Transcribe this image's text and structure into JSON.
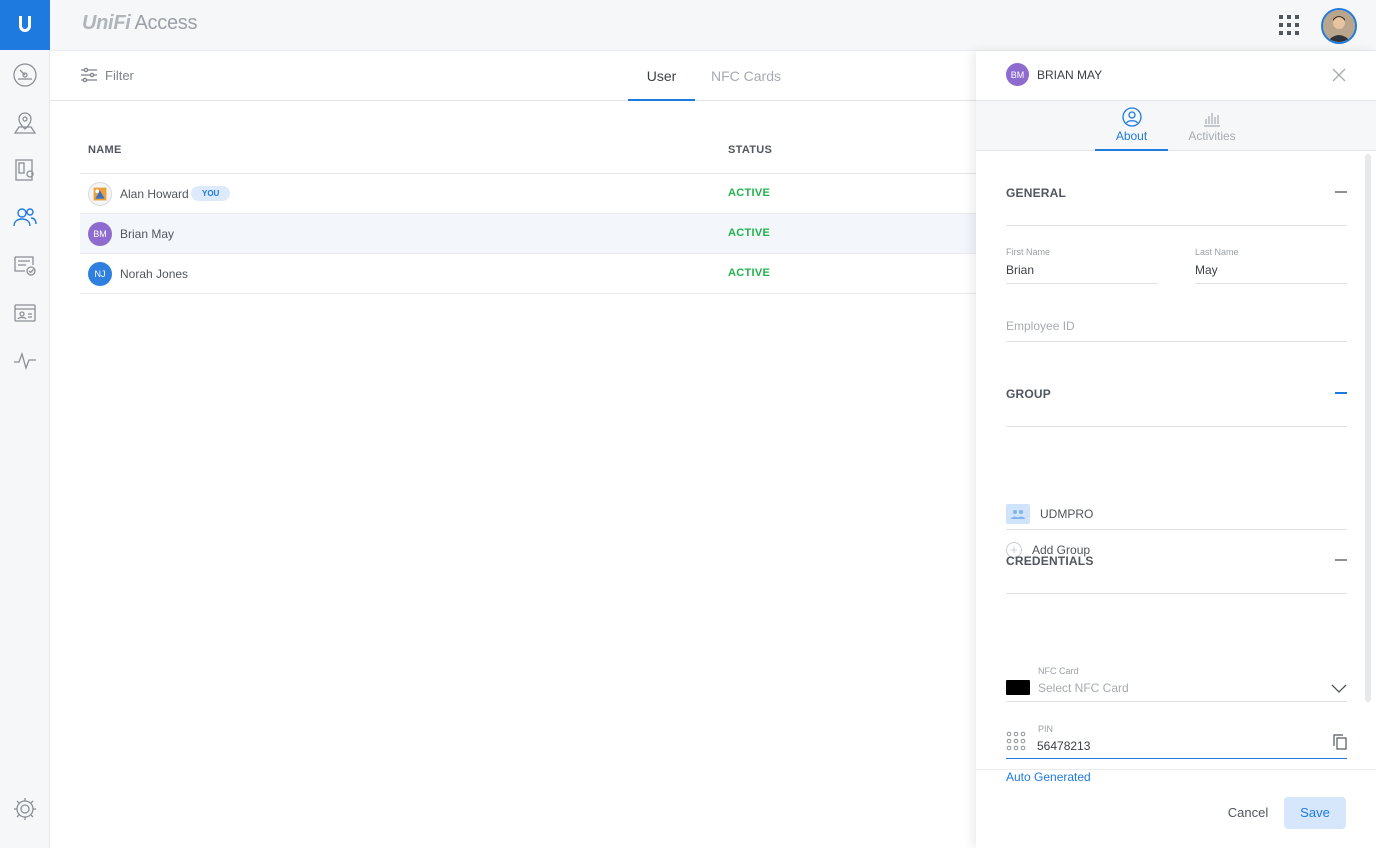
{
  "app": {
    "brand_unifi": "UniFi",
    "brand_product": "Access"
  },
  "rail": {
    "items": [
      {
        "icon": "dashboard-icon"
      },
      {
        "icon": "map-icon"
      },
      {
        "icon": "doors-icon"
      },
      {
        "icon": "users-icon",
        "active": true
      },
      {
        "icon": "access-policy-icon"
      },
      {
        "icon": "id-card-icon"
      },
      {
        "icon": "activity-icon"
      }
    ],
    "settings_icon": "gear-icon"
  },
  "toolbar": {
    "filter_label": "Filter",
    "tabs": [
      {
        "label": "User",
        "active": true
      },
      {
        "label": "NFC Cards",
        "active": false
      }
    ]
  },
  "table": {
    "headers": {
      "name": "NAME",
      "status": "STATUS"
    },
    "rows": [
      {
        "initials": "",
        "name": "Alan Howard",
        "badge": "YOU",
        "status": "ACTIVE",
        "avatar_color": "#e9a23b"
      },
      {
        "initials": "BM",
        "name": "Brian May",
        "badge": "",
        "status": "ACTIVE",
        "avatar_color": "#8e6ccf",
        "selected": true
      },
      {
        "initials": "NJ",
        "name": "Norah Jones",
        "badge": "",
        "status": "ACTIVE",
        "avatar_color": "#2f7fde"
      }
    ]
  },
  "drawer": {
    "header": {
      "initials": "BM",
      "name": "BRIAN MAY"
    },
    "tabs": [
      {
        "label": "About",
        "active": true,
        "icon": "user-circle-icon"
      },
      {
        "label": "Activities",
        "active": false,
        "icon": "bar-chart-icon"
      }
    ],
    "general": {
      "title": "GENERAL",
      "first_name_label": "First Name",
      "first_name_value": "Brian",
      "last_name_label": "Last Name",
      "last_name_value": "May",
      "employee_id_placeholder": "Employee ID"
    },
    "group": {
      "title": "GROUP",
      "groups": [
        "UDMPRO"
      ],
      "add_label": "Add Group"
    },
    "credentials": {
      "title": "CREDENTIALS",
      "nfc_label": "NFC Card",
      "nfc_placeholder": "Select NFC Card",
      "pin_label": "PIN",
      "pin_value": "56478213",
      "auto_generated_label": "Auto Generated"
    },
    "footer": {
      "cancel_label": "Cancel",
      "save_label": "Save"
    }
  },
  "colors": {
    "accent": "#1f7ae0",
    "status_active": "#22b14c"
  }
}
